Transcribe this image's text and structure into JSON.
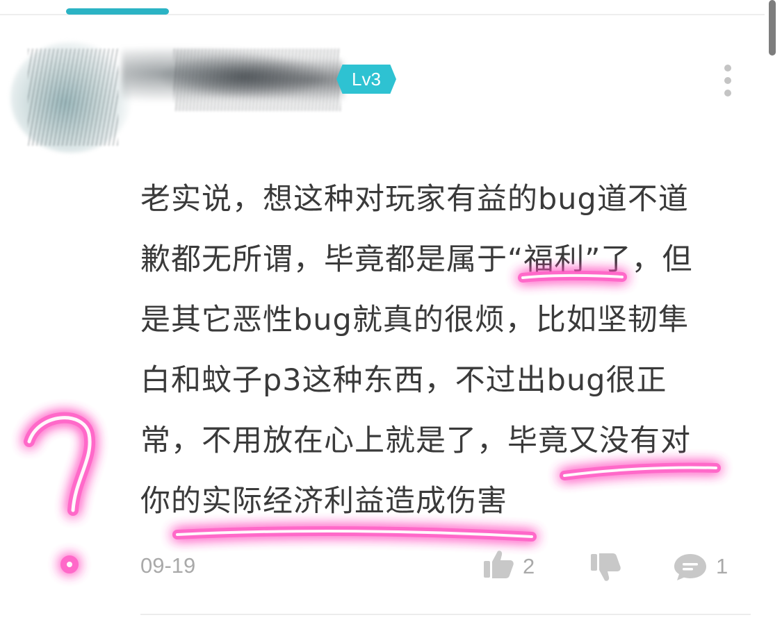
{
  "user": {
    "level_badge": "Lv3"
  },
  "comment": {
    "lines": [
      "老实说，想这种对玩家有益的bug道不道",
      "歉都无所谓，毕竟都是属于“福利”了，但",
      "是其它恶性bug就真的很烦，比如坚韧隼",
      "白和蚊子p3这种东西，不过出bug很正",
      "常，不用放在心上就是了，毕竟又没有对",
      "你的实际经济利益造成伤害"
    ],
    "date": "09-19",
    "like_count": "2",
    "reply_count": "1"
  },
  "colors": {
    "accent": "#2bb3c4",
    "badge": "#2ec2d2",
    "text": "#3a3a3a",
    "muted": "#a9a9a9",
    "highlighter": "#ff4fc0"
  },
  "icons": [
    "more-vertical-icon",
    "thumbs-up-icon",
    "thumbs-down-icon",
    "reply-bubble-icon"
  ]
}
